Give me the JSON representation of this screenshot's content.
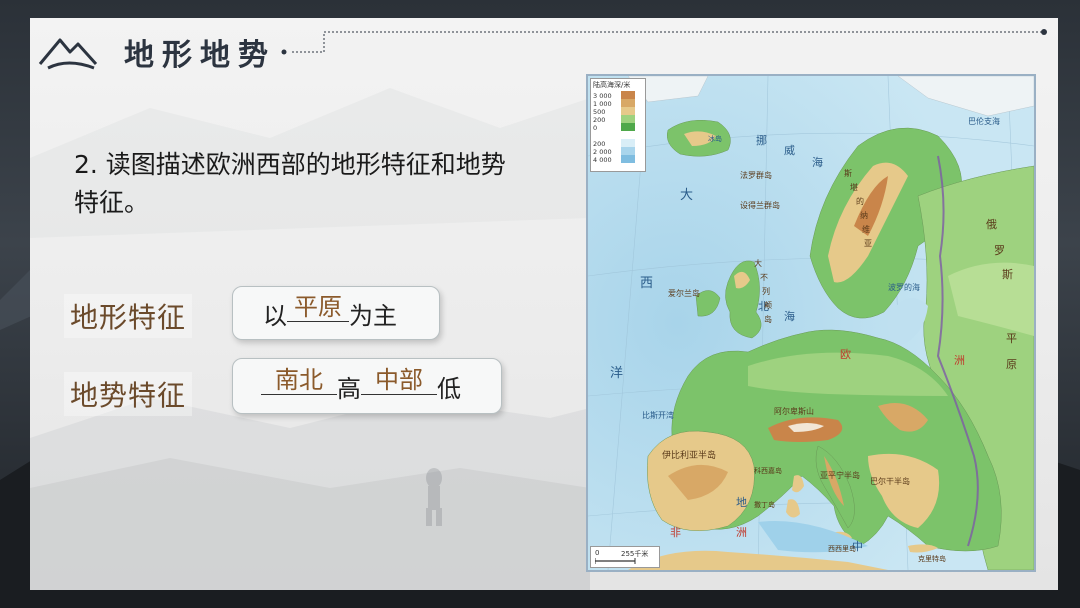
{
  "header": {
    "section_title": "地形地势"
  },
  "question": {
    "text": "2. 读图描述欧洲西部的地形特征和地势特征。"
  },
  "rows": [
    {
      "label": "地形特征",
      "prefix": "以",
      "blank": "平原",
      "suffix": "为主"
    },
    {
      "label": "地势特征",
      "blank1": "南北",
      "middle": "高",
      "blank2": "中部",
      "suffix": "低"
    }
  ],
  "map": {
    "legend": {
      "title": "陆高海深/米",
      "heights": [
        "3 000",
        "1 000",
        "500",
        "200",
        "0"
      ],
      "depths": [
        "200",
        "2 000",
        "4 000"
      ]
    },
    "scale": {
      "zero": "0",
      "value": "255千米"
    },
    "labels": {
      "atlantic_1": "大",
      "atlantic_2": "西",
      "atlantic_3": "洋",
      "norwegian_sea_1": "挪",
      "norwegian_sea_2": "威",
      "norwegian_sea_3": "海",
      "north_sea_1": "北",
      "north_sea_2": "海",
      "mediterranean_1": "地",
      "mediterranean_2": "中",
      "europe_1": "欧",
      "europe_2": "洲",
      "africa_1": "非",
      "africa_2": "洲",
      "russia_1": "俄",
      "russia_2": "罗",
      "russia_3": "斯",
      "plain_1": "平",
      "plain_2": "原",
      "iceland": "冰岛",
      "britain_1": "大",
      "britain_2": "不",
      "britain_3": "列",
      "britain_4": "颠",
      "britain_5": "岛",
      "scandinavia_1": "斯",
      "scandinavia_2": "堪",
      "scandinavia_3": "的",
      "scandinavia_4": "纳",
      "scandinavia_5": "维",
      "scandinavia_6": "亚",
      "iberia": "伊比利亚半岛",
      "alps": "阿尔卑斯山",
      "balkan": "巴尔干半岛",
      "italy": "亚平宁半岛",
      "bay_biscay": "比斯开湾",
      "mediterranean_islands": "科西嘉岛",
      "sardinia": "撒丁岛",
      "sicily": "西西里岛",
      "crete": "克里特岛",
      "baltic": "波罗的海",
      "faroe": "法罗群岛",
      "shetland": "设得兰群岛",
      "ireland": "爱尔兰岛",
      "barents": "巴伦支海"
    }
  },
  "colors": {
    "label_brown": "#6b4a2b",
    "answer_brown": "#8b5a2b",
    "title_dark": "#2c3440",
    "sea": "#c9e6f3",
    "lowland": "#7cc36a",
    "upland": "#e6c98a",
    "mountain": "#c9854a"
  }
}
